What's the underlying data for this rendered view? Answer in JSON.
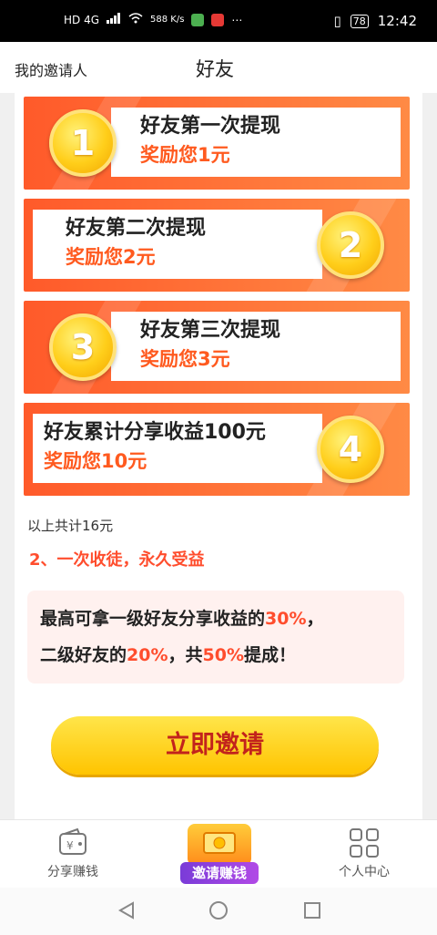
{
  "statusbar": {
    "left_text": "HD 4G",
    "speed": "588 K/s",
    "battery": "78",
    "time": "12:42"
  },
  "header": {
    "inviter": "我的邀请人",
    "title": "好友"
  },
  "cards": [
    {
      "number": "1",
      "line1": "好友第一次提现",
      "line2": "奖励您1元"
    },
    {
      "number": "2",
      "line1": "好友第二次提现",
      "line2": "奖励您2元"
    },
    {
      "number": "3",
      "line1": "好友第三次提现",
      "line2": "奖励您3元"
    },
    {
      "number": "4",
      "line1": "好友累计分享收益100元",
      "line2": "奖励您10元"
    }
  ],
  "summary": "以上共计16元",
  "section2_heading": "2、一次收徒，永久受益",
  "info": {
    "l1_a": "最高可拿一级好友分享收益的",
    "l1_b": "30%",
    "l1_c": "，",
    "l2_a": "二级好友的",
    "l2_b": "20%",
    "l2_c": "，共",
    "l2_d": "50%",
    "l2_e": "提成！"
  },
  "invite_button": "立即邀请",
  "tabs": {
    "share": "分享赚钱",
    "invite": "邀请赚钱",
    "me": "个人中心"
  },
  "colors": {
    "accent": "#ff5a2a",
    "highlight": "#ff4d2d",
    "button": "#ffd21a"
  }
}
